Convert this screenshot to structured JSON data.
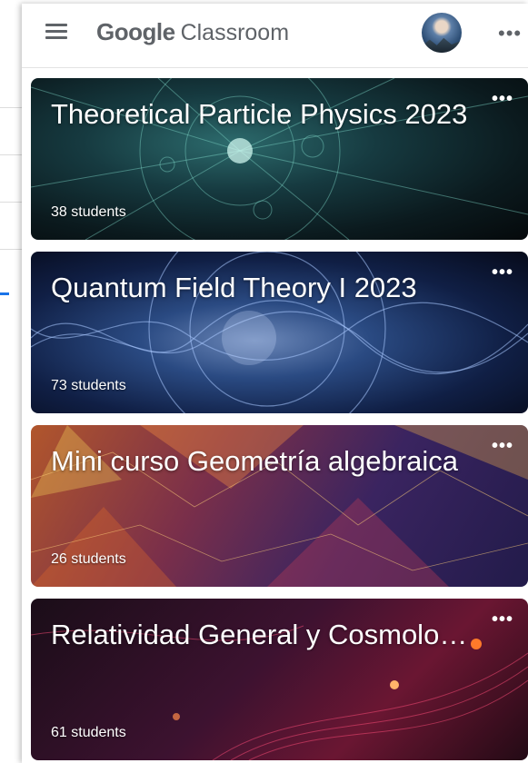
{
  "app": {
    "logo_google": "Google",
    "logo_classroom": "Classroom"
  },
  "icons": {
    "menu": "menu-icon",
    "more": "more-horizontal-icon"
  },
  "courses": [
    {
      "title": "Theoretical Particle Physics 2023",
      "students": "38 students"
    },
    {
      "title": "Quantum Field Theory I 2023",
      "students": "73 students"
    },
    {
      "title": "Mini curso Geometría algebraica",
      "students": "26 students"
    },
    {
      "title": "Relatividad General y Cosmología",
      "students": "61 students"
    }
  ],
  "colors": {
    "text_gray": "#5f6368",
    "accent_blue": "#1a73e8"
  }
}
